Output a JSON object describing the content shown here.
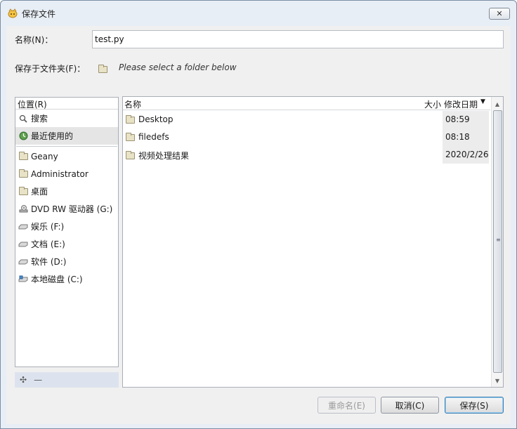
{
  "window": {
    "title": "保存文件",
    "close_label": "✕"
  },
  "form": {
    "name_label": "名称(N)：",
    "name_value": "test.py",
    "folder_label": "保存于文件夹(F)：",
    "folder_hint": "Please select a folder below"
  },
  "places": {
    "header": "位置(R)",
    "items": [
      {
        "label": "搜索",
        "icon": "search-icon"
      },
      {
        "label": "最近使用的",
        "icon": "recent-icon"
      },
      {
        "label": "Geany",
        "icon": "folder-icon"
      },
      {
        "label": "Administrator",
        "icon": "folder-icon"
      },
      {
        "label": "桌面",
        "icon": "folder-icon"
      },
      {
        "label": "DVD RW 驱动器 (G:)",
        "icon": "dvd-drive-icon"
      },
      {
        "label": "娱乐 (F:)",
        "icon": "drive-icon"
      },
      {
        "label": "文档 (E:)",
        "icon": "drive-icon"
      },
      {
        "label": "软件 (D:)",
        "icon": "drive-icon"
      },
      {
        "label": "本地磁盘 (C:)",
        "icon": "system-drive-icon"
      }
    ],
    "add_label": "✣",
    "remove_label": "—"
  },
  "files": {
    "columns": {
      "name": "名称",
      "size": "大小",
      "modified": "修改日期"
    },
    "sort_indicator": "▼",
    "rows": [
      {
        "name": "Desktop",
        "modified": "08:59"
      },
      {
        "name": "filedefs",
        "modified": "08:18"
      },
      {
        "name": "视频处理结果",
        "modified": "2020/2/26"
      }
    ]
  },
  "buttons": {
    "rename": "重命名(E)",
    "cancel": "取消(C)",
    "save": "保存(S)"
  }
}
